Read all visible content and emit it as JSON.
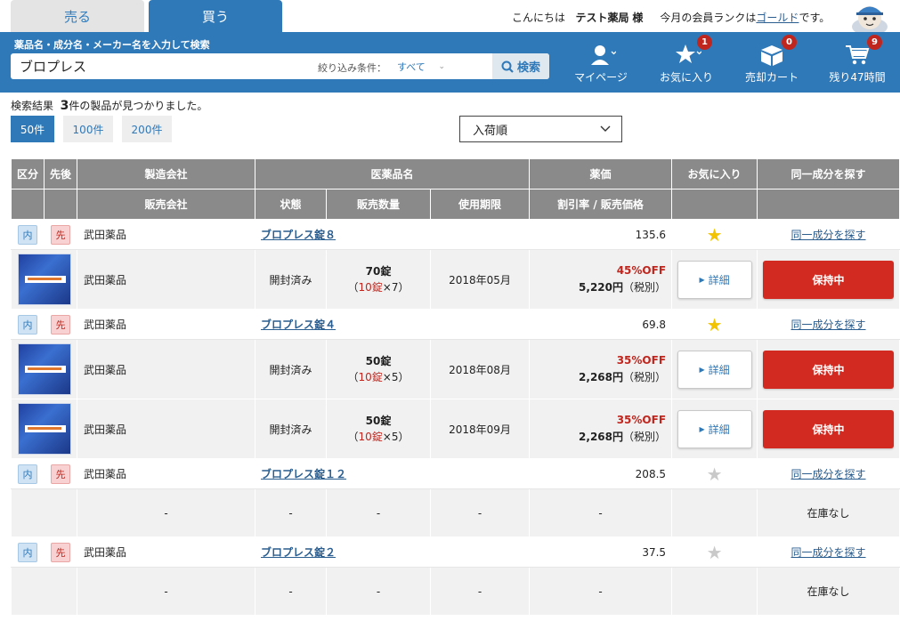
{
  "tabs": {
    "sell": "売る",
    "buy": "買う"
  },
  "greeting": {
    "prefix": "こんにちは",
    "user": "テスト薬局",
    "suffix": "様",
    "rank_prefix": "今月の会員ランクは",
    "rank": "ゴールド",
    "rank_suffix": "です。"
  },
  "search": {
    "caption": "薬品名・成分名・メーカー名を入力して検索",
    "value": "ブロプレス",
    "filter_label": "絞り込み条件：",
    "filter_value": "すべて",
    "button": "検索"
  },
  "nav": {
    "mypage": {
      "label": "マイページ"
    },
    "favorites": {
      "label": "お気に入り",
      "badge": "1"
    },
    "sell_cart": {
      "label": "売却カート",
      "badge": "0"
    },
    "buy_cart": {
      "label": "残り47時間",
      "badge": "9"
    }
  },
  "results": {
    "prefix": "検索結果",
    "count": "3",
    "suffix": "件の製品が見つかりました。"
  },
  "pager": [
    "50件",
    "100件",
    "200件"
  ],
  "sort": {
    "value": "入荷順"
  },
  "headers": {
    "row1": [
      "区分",
      "先後",
      "製造会社",
      "医薬品名",
      "薬価",
      "お気に入り",
      "同一成分を探す"
    ],
    "row2": [
      "販売会社",
      "状態",
      "販売数量",
      "使用期限",
      "割引率 / 販売価格"
    ]
  },
  "products": [
    {
      "tag1": "内",
      "tag2": "先",
      "maker": "武田薬品",
      "name": "ブロプレス錠８",
      "price": "135.6",
      "favorite": true,
      "same": "同一成分を探す",
      "listings": [
        {
          "seller": "武田薬品",
          "state": "開封済み",
          "qty": "70錠",
          "unit": "10錠",
          "mult": "×7",
          "expiry": "2018年05月",
          "discount": "45%OFF",
          "sale": "5,220円",
          "tax": "（税別）",
          "detail": "詳細",
          "action": "保持中"
        }
      ]
    },
    {
      "tag1": "内",
      "tag2": "先",
      "maker": "武田薬品",
      "name": "ブロプレス錠４",
      "price": "69.8",
      "favorite": true,
      "same": "同一成分を探す",
      "listings": [
        {
          "seller": "武田薬品",
          "state": "開封済み",
          "qty": "50錠",
          "unit": "10錠",
          "mult": "×5",
          "expiry": "2018年08月",
          "discount": "35%OFF",
          "sale": "2,268円",
          "tax": "（税別）",
          "detail": "詳細",
          "action": "保持中"
        },
        {
          "seller": "武田薬品",
          "state": "開封済み",
          "qty": "50錠",
          "unit": "10錠",
          "mult": "×5",
          "expiry": "2018年09月",
          "discount": "35%OFF",
          "sale": "2,268円",
          "tax": "（税別）",
          "detail": "詳細",
          "action": "保持中"
        }
      ]
    },
    {
      "tag1": "内",
      "tag2": "先",
      "maker": "武田薬品",
      "name": "ブロプレス錠１２",
      "price": "208.5",
      "favorite": false,
      "same": "同一成分を探す",
      "nostock": {
        "dash": "-",
        "label": "在庫なし"
      }
    },
    {
      "tag1": "内",
      "tag2": "先",
      "maker": "武田薬品",
      "name": "ブロプレス錠２",
      "price": "37.5",
      "favorite": false,
      "same": "同一成分を探す",
      "nostock": {
        "dash": "-",
        "label": "在庫なし"
      }
    }
  ],
  "colors": {
    "brand": "#2f79b9",
    "accent": "#d22a20",
    "star": "#f2c300"
  }
}
